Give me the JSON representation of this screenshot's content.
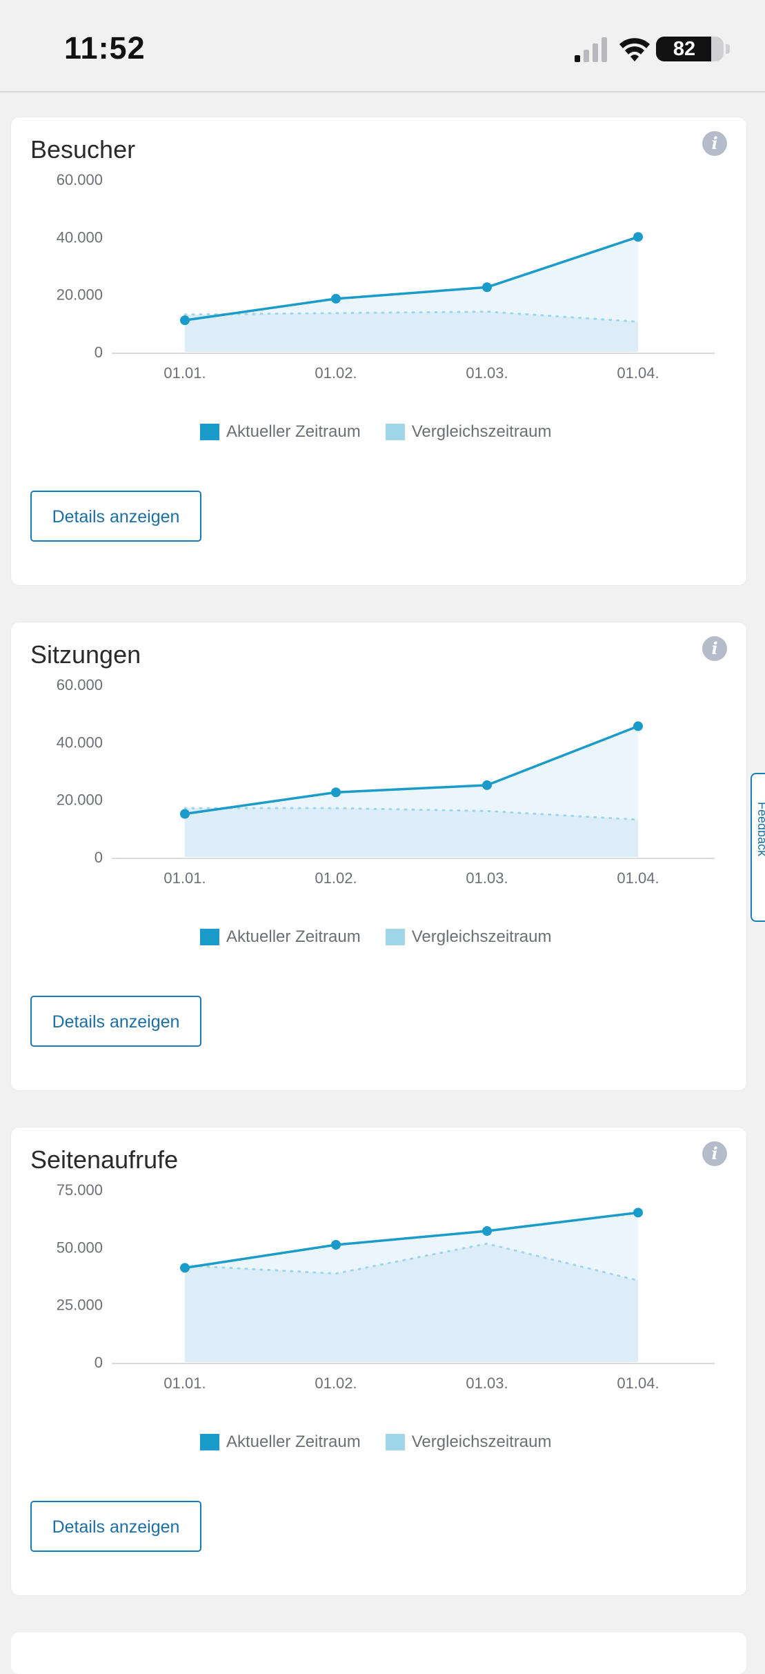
{
  "status_bar": {
    "time": "11:52",
    "battery": "82",
    "battery_level": 0.82,
    "icons": [
      "signal-icon",
      "wifi-icon",
      "battery-icon"
    ]
  },
  "colors": {
    "accent": "#1a9bc9",
    "compare": "#9fd6ea",
    "area_current": "#eaf5fc",
    "area_compare": "#dcedf8",
    "button_border": "#1a7bb9"
  },
  "legend": {
    "current": "Aktueller Zeitraum",
    "compare": "Vergleichszeitraum"
  },
  "feedback_label": "Feedback",
  "cards": [
    {
      "title": "Besucher",
      "button_label": "Details anzeigen",
      "chart_data": {
        "type": "area",
        "categories": [
          "01.01.",
          "01.02.",
          "01.03.",
          "01.04."
        ],
        "yticks": [
          "0",
          "20.000",
          "40.000",
          "60.000"
        ],
        "ylim": [
          0,
          60000
        ],
        "series": [
          {
            "name": "Aktueller Zeitraum",
            "values": [
              11000,
              18500,
              22500,
              40000
            ]
          },
          {
            "name": "Vergleichszeitraum",
            "values": [
              13000,
              13500,
              14000,
              10500
            ]
          }
        ],
        "legend": "bottom"
      }
    },
    {
      "title": "Sitzungen",
      "button_label": "Details anzeigen",
      "chart_data": {
        "type": "area",
        "categories": [
          "01.01.",
          "01.02.",
          "01.03.",
          "01.04."
        ],
        "yticks": [
          "0",
          "20.000",
          "40.000",
          "60.000"
        ],
        "ylim": [
          0,
          60000
        ],
        "series": [
          {
            "name": "Aktueller Zeitraum",
            "values": [
              15000,
              22500,
              25000,
              45500
            ]
          },
          {
            "name": "Vergleichszeitraum",
            "values": [
              17000,
              17000,
              16000,
              13000
            ]
          }
        ],
        "legend": "bottom"
      }
    },
    {
      "title": "Seitenaufrufe",
      "button_label": "Details anzeigen",
      "chart_data": {
        "type": "area",
        "categories": [
          "01.01.",
          "01.02.",
          "01.03.",
          "01.04."
        ],
        "yticks": [
          "0",
          "25.000",
          "50.000",
          "75.000"
        ],
        "ylim": [
          0,
          75000
        ],
        "series": [
          {
            "name": "Aktueller Zeitraum",
            "values": [
              41000,
              51000,
              57000,
              65000
            ]
          },
          {
            "name": "Vergleichszeitraum",
            "values": [
              42000,
              38500,
              51500,
              35500
            ]
          }
        ],
        "legend": "bottom"
      }
    }
  ]
}
